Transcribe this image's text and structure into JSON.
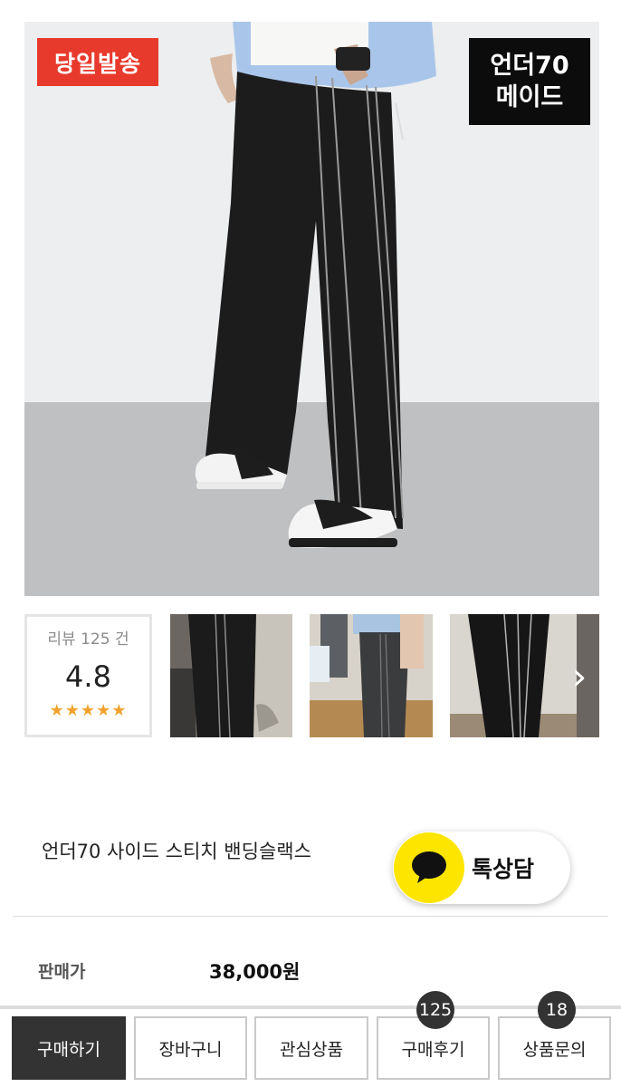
{
  "hero": {
    "badge_left": "당일발송",
    "badge_right_line1": "언더70",
    "badge_right_line2": "메이드",
    "badge_left_color": "#e83a2c"
  },
  "reviews": {
    "count_label": "리뷰 125 건",
    "score": "4.8",
    "stars": "★★★★★",
    "star_rating": 4.8,
    "star_color": "#f2a22c"
  },
  "thumbnails": {
    "next_icon": "chevron-right-icon"
  },
  "product": {
    "title": "언더70 사이드 스티치 밴딩슬랙스",
    "talk_label": "톡상담",
    "talk_icon": "speech-bubble-icon",
    "talk_color": "#fee500",
    "price_label": "판매가",
    "price_value": "38,000원"
  },
  "bottom_bar": {
    "buy": "구매하기",
    "cart": "장바구니",
    "wishlist": "관심상품",
    "reviews": "구매후기",
    "reviews_count": "125",
    "qna": "상품문의",
    "qna_count": "18"
  }
}
